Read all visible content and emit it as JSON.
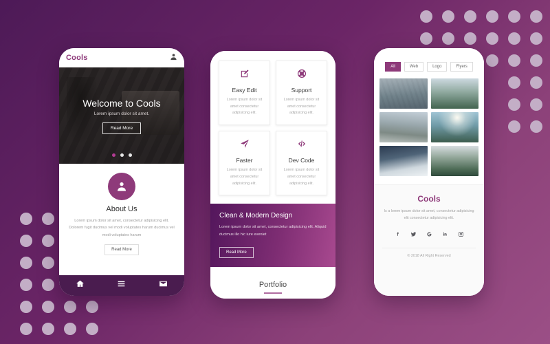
{
  "background": {
    "gradient_from": "#4d1a57",
    "gradient_to": "#9b4f86",
    "dot_color": "#c3aec6"
  },
  "phone_one": {
    "header": {
      "logo": "Cools",
      "account_icon": "user-icon"
    },
    "hero": {
      "title": "Welcome to Cools",
      "subtitle": "Lorem ipsum dolor sit amet.",
      "button": "Read More",
      "slides": 3,
      "active_slide": 1
    },
    "about": {
      "icon": "user-icon",
      "title": "About Us",
      "text": "Lorem ipsum dolor sit amet, consectetur adipisicing elit. Dolorem fugit ducimus vel modi voluptates harum ducimus vel modi voluptates harum",
      "button": "Read More"
    },
    "bottom_nav": [
      {
        "name": "home-icon"
      },
      {
        "name": "menu-icon"
      },
      {
        "name": "mail-icon"
      }
    ]
  },
  "phone_two": {
    "features": [
      {
        "icon": "edit-icon",
        "title": "Easy Edit",
        "text": "Lorem ipsum dolor sit amet consectetur adipisicing elit."
      },
      {
        "icon": "lifebuoy-icon",
        "title": "Support",
        "text": "Lorem ipsum dolor sit amet consectetur adipisicing elit."
      },
      {
        "icon": "paper-plane-icon",
        "title": "Faster",
        "text": "Lorem ipsum dolor sit amet consectetur adipisicing elit."
      },
      {
        "icon": "code-icon",
        "title": "Dev Code",
        "text": "Lorem ipsum dolor sit amet consectetur adipisicing elit."
      }
    ],
    "banner": {
      "title": "Clean & Modern Design",
      "text": "Lorem ipsum dolor sit amet, consectetur adipisicing elit. Aliquid ducimus illo hic iure eveniet",
      "button": "Read More"
    },
    "portfolio": {
      "title": "Portfolio"
    }
  },
  "phone_three": {
    "filters": [
      {
        "label": "All",
        "active": true
      },
      {
        "label": "Web",
        "active": false
      },
      {
        "label": "Logo",
        "active": false
      },
      {
        "label": "Flyers",
        "active": false
      }
    ],
    "gallery": [
      {
        "alt": "misty-lake-with-pine-branch"
      },
      {
        "alt": "mountain-lake-trail"
      },
      {
        "alt": "winter-road-through-valley"
      },
      {
        "alt": "person-on-cliff-at-sunrise"
      },
      {
        "alt": "snow-covered-mountain-peak"
      },
      {
        "alt": "forest-river-canyon"
      }
    ],
    "footer": {
      "title": "Cools",
      "text": "Is a lorem ipsum dolor sit amet, consectetur adipisicing elit consectetur adipisicing elit.",
      "socials": [
        {
          "name": "facebook-icon"
        },
        {
          "name": "twitter-icon"
        },
        {
          "name": "google-icon"
        },
        {
          "name": "linkedin-icon"
        },
        {
          "name": "instagram-icon"
        }
      ],
      "copyright": "© 2018 All Right Reserved"
    }
  }
}
